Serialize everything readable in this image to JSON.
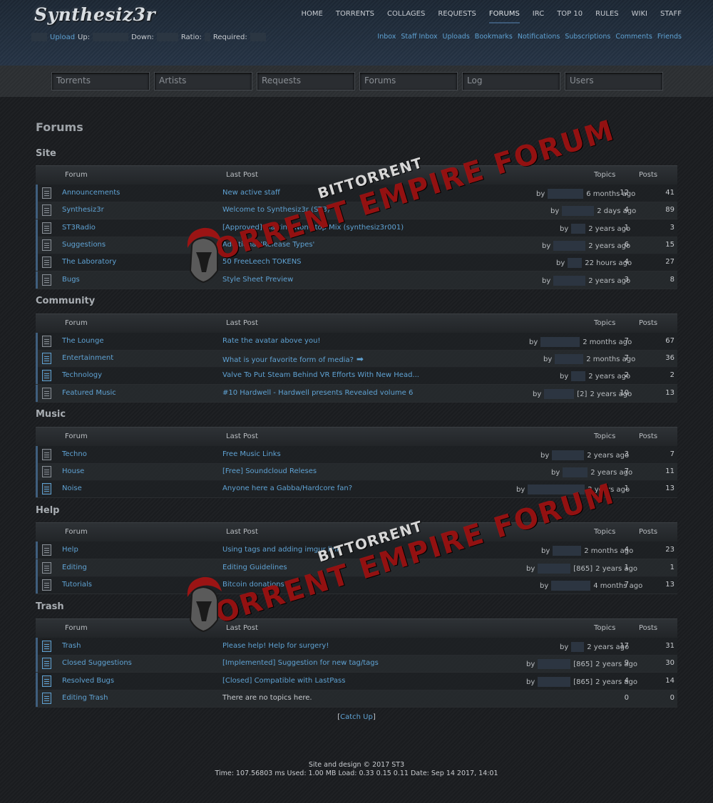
{
  "site": {
    "logo": "Synthesiz3r",
    "userbar": {
      "upload_link": "Upload",
      "up_label": "Up:",
      "down_label": "Down:",
      "ratio_label": "Ratio:",
      "required_label": "Required:"
    },
    "mainnav": [
      "HOME",
      "TORRENTS",
      "COLLAGES",
      "REQUESTS",
      "FORUMS",
      "IRC",
      "TOP 10",
      "RULES",
      "WIKI",
      "STAFF"
    ],
    "active_nav": "FORUMS",
    "subnav": [
      "Inbox",
      "Staff Inbox",
      "Uploads",
      "Bookmarks",
      "Notifications",
      "Subscriptions",
      "Comments",
      "Friends"
    ],
    "search_placeholders": [
      "Torrents",
      "Artists",
      "Requests",
      "Forums",
      "Log",
      "Users"
    ]
  },
  "page": {
    "title": "Forums"
  },
  "columns": {
    "forum": "Forum",
    "last_post": "Last Post",
    "topics": "Topics",
    "posts": "Posts"
  },
  "watermark": {
    "line1": "BITTORRENT",
    "line2": "TORRENT EMPIRE FORUM"
  },
  "sections": [
    {
      "title": "Site",
      "rows": [
        {
          "forum": "Announcements",
          "last_post": "New active staff",
          "by": "by",
          "suffix": "",
          "time": "6 months ago",
          "topics": "12",
          "posts": "41",
          "icon": "read"
        },
        {
          "forum": "Synthesiz3r",
          "last_post": "Welcome to Synthesiz3r (ST3)",
          "by": "by",
          "suffix": "",
          "time": "2 days ago",
          "topics": "4",
          "posts": "89",
          "icon": "read"
        },
        {
          "forum": "ST3Radio",
          "last_post": "[Approved] Martin - Non-stop Mix (synthesiz3r001)",
          "by": "by",
          "suffix": "",
          "time": "2 years ago",
          "topics": "1",
          "posts": "3",
          "icon": "read"
        },
        {
          "forum": "Suggestions",
          "last_post": "Additional 'Release Types'",
          "by": "by",
          "suffix": "",
          "time": "2 years ago",
          "topics": "6",
          "posts": "15",
          "icon": "read"
        },
        {
          "forum": "The Laboratory",
          "last_post": "50 FreeLeech TOKENS",
          "by": "by",
          "suffix": "",
          "time": "22 hours ago",
          "topics": "4",
          "posts": "27",
          "icon": "read"
        },
        {
          "forum": "Bugs",
          "last_post": "Style Sheet Preview",
          "by": "by",
          "suffix": "",
          "time": "2 years ago",
          "topics": "3",
          "posts": "8",
          "icon": "read"
        }
      ]
    },
    {
      "title": "Community",
      "rows": [
        {
          "forum": "The Lounge",
          "last_post": "Rate the avatar above you!",
          "by": "by",
          "suffix": "",
          "time": "2 months ago",
          "topics": "7",
          "posts": "67",
          "icon": "read"
        },
        {
          "forum": "Entertainment",
          "last_post": "What is your favorite form of media?",
          "by": "by",
          "suffix": "",
          "time": "2 months ago",
          "topics": "7",
          "posts": "36",
          "icon": "new",
          "arrow": true
        },
        {
          "forum": "Technology",
          "last_post": "Valve To Put Steam Behind VR Efforts With New Head...",
          "by": "by",
          "suffix": "",
          "time": "2 years ago",
          "topics": "2",
          "posts": "2",
          "icon": "new"
        },
        {
          "forum": "Featured Music",
          "last_post": "#10 Hardwell - Hardwell presents Revealed volume 6",
          "by": "by",
          "suffix": "[2]",
          "time": "2 years ago",
          "topics": "10",
          "posts": "13",
          "icon": "read"
        }
      ]
    },
    {
      "title": "Music",
      "rows": [
        {
          "forum": "Techno",
          "last_post": "Free Music Links",
          "by": "by",
          "suffix": "",
          "time": "2 years ago",
          "topics": "3",
          "posts": "7",
          "icon": "read"
        },
        {
          "forum": "House",
          "last_post": "[Free] Soundcloud Releses",
          "by": "by",
          "suffix": "",
          "time": "2 years ago",
          "topics": "7",
          "posts": "11",
          "icon": "read"
        },
        {
          "forum": "Noise",
          "last_post": "Anyone here a Gabba/Hardcore fan?",
          "by": "by",
          "suffix": "",
          "time": "2 years ago",
          "topics": "1",
          "posts": "13",
          "icon": "new"
        }
      ]
    },
    {
      "title": "Help",
      "rows": [
        {
          "forum": "Help",
          "last_post": "Using tags and adding imgur link",
          "by": "by",
          "suffix": "",
          "time": "2 months ago",
          "topics": "4",
          "posts": "23",
          "icon": "read"
        },
        {
          "forum": "Editing",
          "last_post": "Editing Guidelines",
          "by": "by",
          "suffix": "[865]",
          "time": "2 years ago",
          "topics": "1",
          "posts": "1",
          "icon": "read"
        },
        {
          "forum": "Tutorials",
          "last_post": "Bitcoin donations",
          "by": "by",
          "suffix": "",
          "time": "4 months ago",
          "topics": "7",
          "posts": "13",
          "icon": "read"
        }
      ]
    },
    {
      "title": "Trash",
      "rows": [
        {
          "forum": "Trash",
          "last_post": "Please help! Help for surgery!",
          "by": "by",
          "suffix": "",
          "time": "2 years ago",
          "topics": "17",
          "posts": "31",
          "icon": "new"
        },
        {
          "forum": "Closed Suggestions",
          "last_post": "[Implemented] Suggestion for new tag/tags",
          "by": "by",
          "suffix": "[865]",
          "time": "2 years ago",
          "topics": "9",
          "posts": "30",
          "icon": "new"
        },
        {
          "forum": "Resolved Bugs",
          "last_post": "[Closed] Compatible with LastPass",
          "by": "by",
          "suffix": "[865]",
          "time": "2 years ago",
          "topics": "4",
          "posts": "14",
          "icon": "new"
        },
        {
          "forum": "Editing Trash",
          "last_post": "There are no topics here.",
          "by": "",
          "suffix": "",
          "time": "",
          "topics": "0",
          "posts": "0",
          "icon": "new",
          "plain": true
        }
      ]
    }
  ],
  "catchup": {
    "left": "[",
    "link": "Catch Up",
    "right": "]"
  },
  "footer": {
    "line1": "Site and design © 2017 ST3",
    "line2": "Time: 107.56803 ms Used: 1.00 MB Load: 0.33 0.15 0.11 Date: Sep 14 2017, 14:01"
  }
}
